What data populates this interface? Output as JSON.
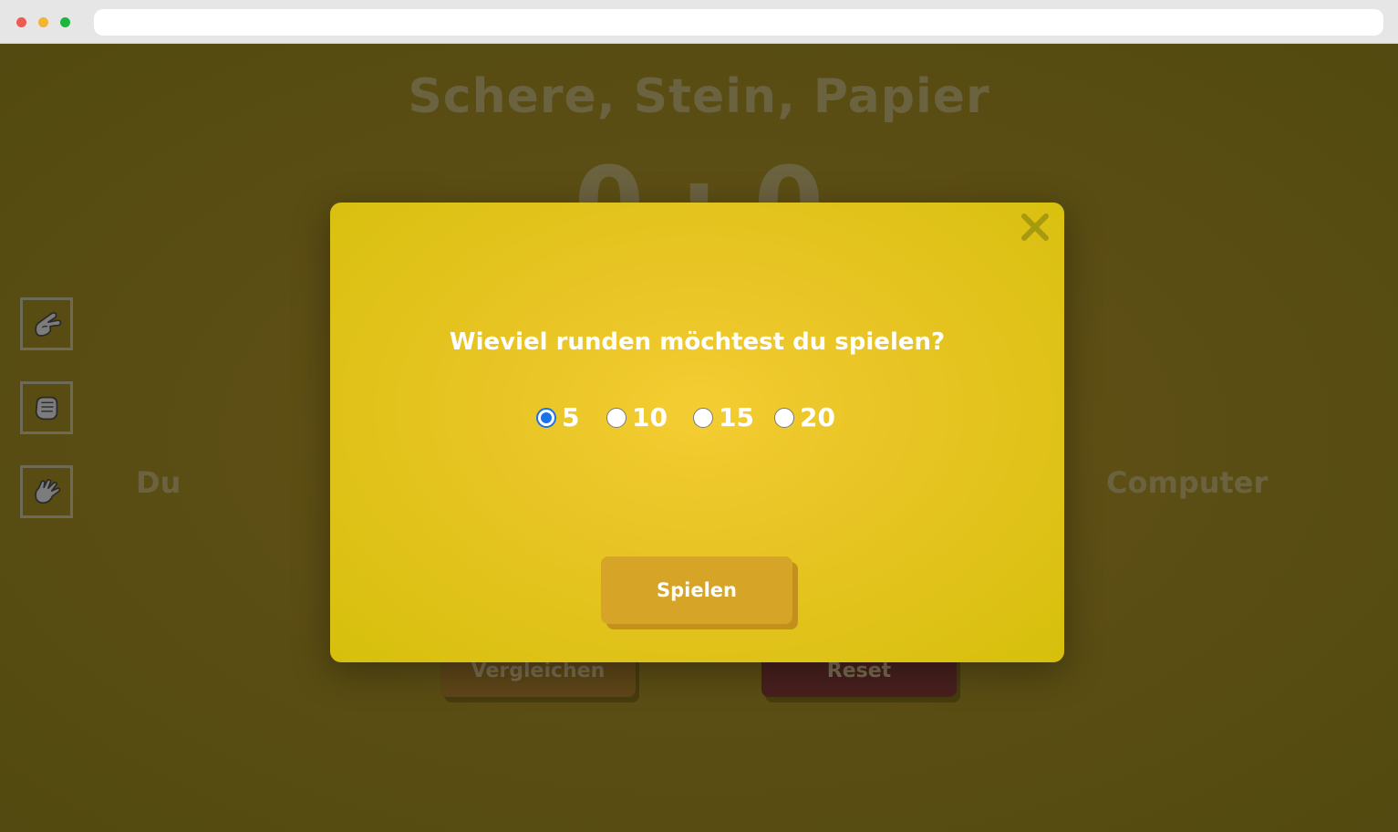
{
  "window": {
    "url": ""
  },
  "game": {
    "title": "Schere, Stein, Papier",
    "score": "0 : 0",
    "player_label": "Du",
    "computer_label": "Computer",
    "choices": [
      {
        "name": "scissors",
        "icon": "scissors-hand-icon"
      },
      {
        "name": "rock",
        "icon": "rock-fist-icon"
      },
      {
        "name": "paper",
        "icon": "paper-hand-icon"
      }
    ],
    "compare_label": "Vergleichen",
    "reset_label": "Reset"
  },
  "modal": {
    "question": "Wieviel runden möchtest du spielen?",
    "options": [
      "5",
      "10",
      "15",
      "20"
    ],
    "selected": "5",
    "play_label": "Spielen",
    "close_icon": "close-icon"
  },
  "colors": {
    "modal_accent": "#f4cd32",
    "play_button": "#d6a426",
    "radio_checked": "#1a73e8"
  }
}
